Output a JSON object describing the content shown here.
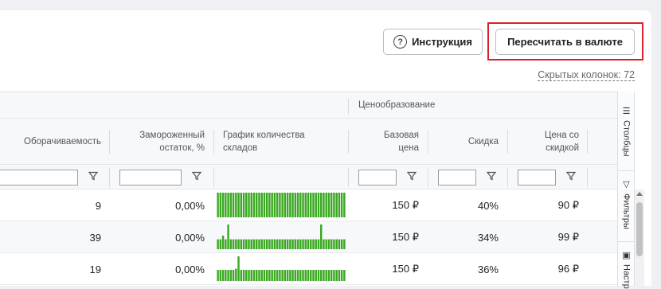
{
  "toolbar": {
    "help_label": "Инструкция",
    "help_icon": "question-circle-icon",
    "recalc_label": "Пересчитать в валюте",
    "hidden_columns": "Скрытых колонок: 72"
  },
  "table": {
    "group_label": "Ценообразование",
    "headers": {
      "turnover": "Оборачиваемость",
      "frozen": "Замороженный остаток, %",
      "chart": "График количества складов",
      "base_price": "Базовая цена",
      "discount": "Скидка",
      "discount_price": "Цена со скидкой"
    },
    "rows": [
      {
        "turnover": "9",
        "frozen": "0,00%",
        "base_price": "150 ₽",
        "discount": "40%",
        "discount_price": "90 ₽",
        "spark": [
          1,
          1,
          1,
          1,
          1,
          1,
          1,
          1,
          1,
          1,
          1,
          1,
          1,
          1,
          1,
          1,
          1,
          1,
          1,
          1,
          1,
          1,
          1,
          1,
          1,
          1,
          1,
          1,
          1,
          1,
          1,
          1,
          1,
          1,
          1,
          1,
          1,
          1,
          1,
          1,
          1,
          1,
          1,
          1,
          1,
          1,
          1,
          1,
          1,
          1
        ]
      },
      {
        "turnover": "39",
        "frozen": "0,00%",
        "base_price": "150 ₽",
        "discount": "34%",
        "discount_price": "99 ₽",
        "spark": [
          0.4,
          0.4,
          0.55,
          0.4,
          1,
          0.4,
          0.4,
          0.4,
          0.4,
          0.4,
          0.4,
          0.4,
          0.4,
          0.4,
          0.4,
          0.4,
          0.4,
          0.4,
          0.4,
          0.4,
          0.4,
          0.4,
          0.4,
          0.4,
          0.4,
          0.4,
          0.4,
          0.4,
          0.4,
          0.4,
          0.4,
          0.4,
          0.4,
          0.4,
          0.4,
          0.4,
          0.4,
          0.4,
          0.4,
          0.4,
          1,
          0.4,
          0.4,
          0.4,
          0.4,
          0.4,
          0.4,
          0.4,
          0.4,
          0.4
        ]
      },
      {
        "turnover": "19",
        "frozen": "0,00%",
        "base_price": "150 ₽",
        "discount": "36%",
        "discount_price": "96 ₽",
        "spark": [
          0.45,
          0.45,
          0.45,
          0.45,
          0.45,
          0.45,
          0.45,
          0.5,
          1,
          0.45,
          0.45,
          0.45,
          0.45,
          0.45,
          0.45,
          0.45,
          0.45,
          0.45,
          0.45,
          0.45,
          0.45,
          0.45,
          0.45,
          0.45,
          0.45,
          0.45,
          0.45,
          0.45,
          0.45,
          0.45,
          0.45,
          0.45,
          0.45,
          0.45,
          0.45,
          0.45,
          0.45,
          0.45,
          0.45,
          0.45,
          0.45,
          0.45,
          0.45,
          0.45,
          0.45,
          0.45,
          0.45,
          0.45,
          0.45,
          0.45
        ]
      }
    ]
  },
  "side_panel": {
    "columns_label": "Столбцы",
    "filters_label": "Фильтры",
    "settings_label": "Настр"
  },
  "colors": {
    "spark": "#3aa821",
    "accent_border": "#d9202a"
  }
}
